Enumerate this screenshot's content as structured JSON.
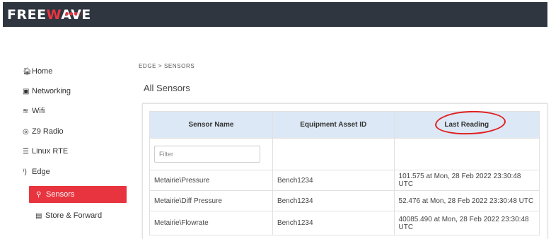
{
  "header": {
    "logo_left": "FREE",
    "logo_accent": "W",
    "logo_right": "AVE",
    "logo_dots": "●●●○"
  },
  "sidebar": {
    "items": [
      {
        "label": "Home",
        "icon": "home-icon",
        "glyph": "🏠︎"
      },
      {
        "label": "Networking",
        "icon": "networking-icon",
        "glyph": "▣"
      },
      {
        "label": "Wifi",
        "icon": "wifi-icon",
        "glyph": "≋"
      },
      {
        "label": "Z9 Radio",
        "icon": "radio-icon",
        "glyph": "◎"
      },
      {
        "label": "Linux RTE",
        "icon": "linux-icon",
        "glyph": "☰"
      },
      {
        "label": "Edge",
        "icon": "edge-icon",
        "glyph": "⁾)"
      }
    ],
    "active": {
      "label": "Sensors",
      "icon": "sensor-icon",
      "glyph": "⚲"
    },
    "sub": {
      "label": "Store & Forward",
      "icon": "book-icon",
      "glyph": "▤"
    }
  },
  "breadcrumb": "EDGE > SENSORS",
  "page_title": "All Sensors",
  "table": {
    "headers": [
      "Sensor Name",
      "Equipment Asset ID",
      "Last Reading"
    ],
    "filter_placeholder": "Filter",
    "rows": [
      {
        "name": "Metairie\\Pressure",
        "asset": "Bench1234",
        "reading": "101.575 at Mon, 28 Feb 2022 23:30:48 UTC"
      },
      {
        "name": "Metairie\\Diff Pressure",
        "asset": "Bench1234",
        "reading": "52.476 at Mon, 28 Feb 2022 23:30:48 UTC"
      },
      {
        "name": "Metairie\\Flowrate",
        "asset": "Bench1234",
        "reading": "40085.490 at Mon, 28 Feb 2022 23:30:48 UTC"
      }
    ]
  },
  "colors": {
    "topbar": "#2f3640",
    "accent": "#e8343f",
    "table_header": "#dce8f5",
    "annotation": "#e02020"
  }
}
